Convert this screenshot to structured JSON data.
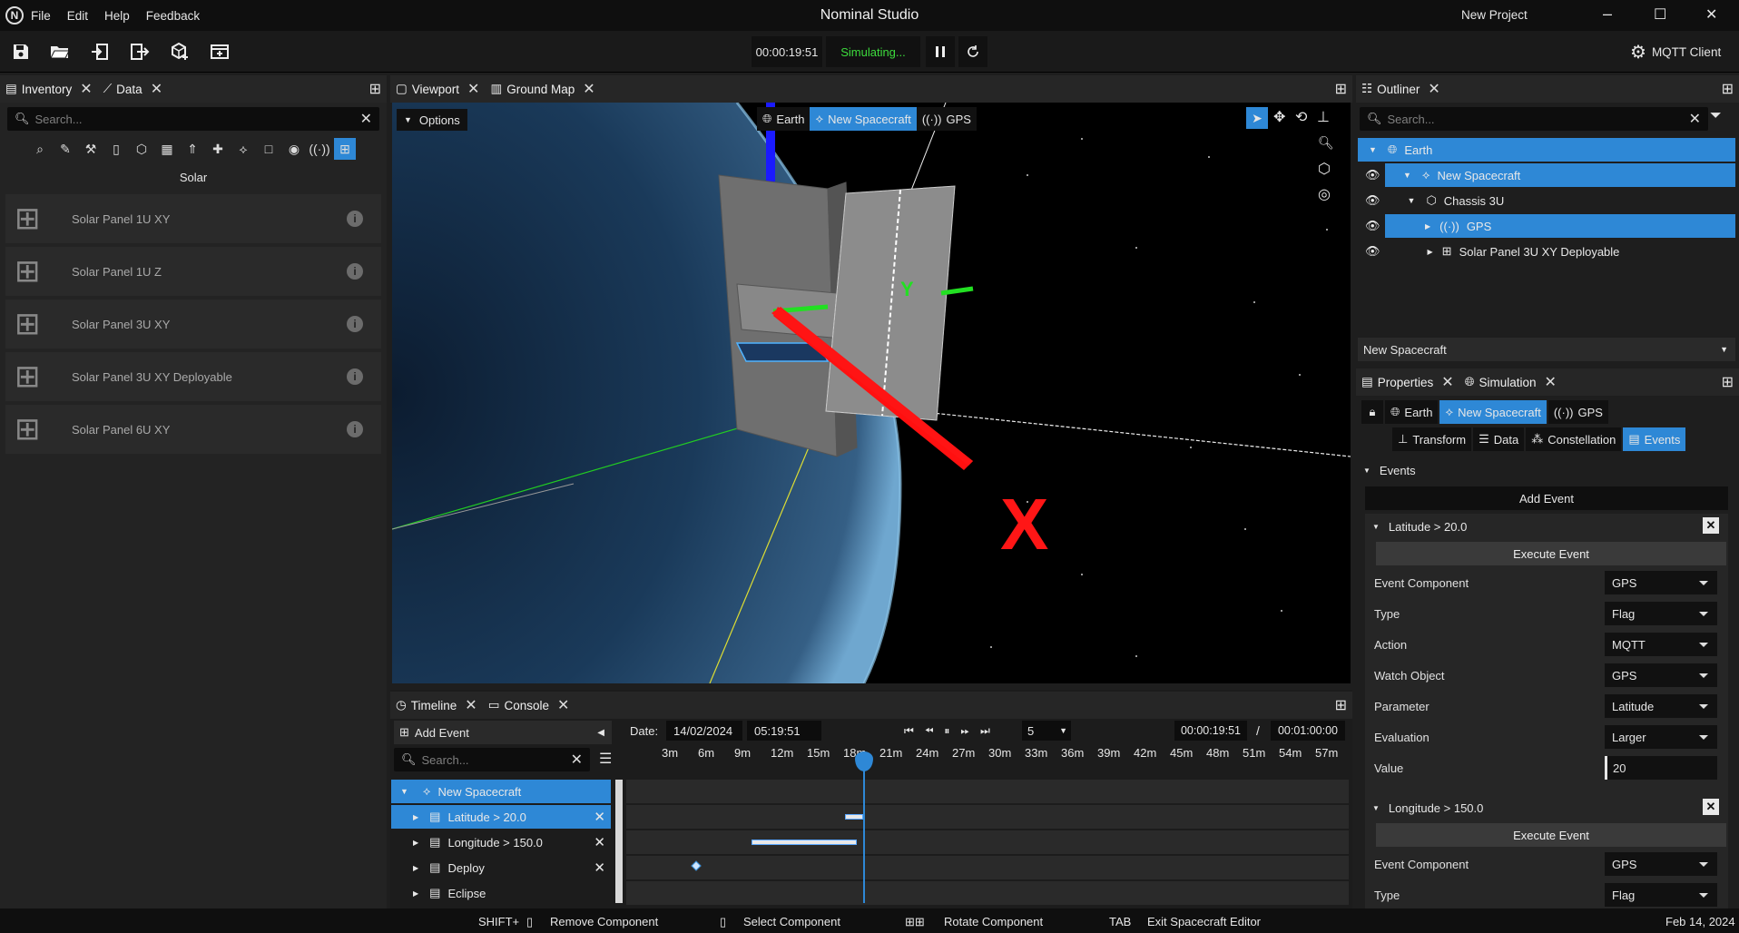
{
  "app": {
    "logo": "N",
    "menu": [
      "File",
      "Edit",
      "Help",
      "Feedback"
    ],
    "title": "Nominal Studio",
    "project": "New Project",
    "window": {
      "min": "–",
      "max": "☐",
      "close": "✕"
    }
  },
  "toolbar": {
    "icons": [
      "save-icon",
      "open-folder-icon",
      "import-icon",
      "export-icon",
      "add-cube-icon",
      "add-panel-icon"
    ],
    "sim_time": "00:00:19:51",
    "sim_status": "Simulating...",
    "mqtt": "MQTT Client"
  },
  "inventory": {
    "tabs": [
      "Inventory",
      "Data"
    ],
    "search_placeholder": "Search...",
    "category": "Solar",
    "items": [
      "Solar Panel 1U XY",
      "Solar Panel 1U Z",
      "Solar Panel 3U XY",
      "Solar Panel 3U XY Deployable",
      "Solar Panel 6U XY"
    ]
  },
  "viewport": {
    "tabs": [
      "Viewport",
      "Ground Map"
    ],
    "options": "Options",
    "crumbs": [
      "Earth",
      "New Spacecraft",
      "GPS"
    ],
    "axis_y": "Y",
    "axis_x": "X"
  },
  "outliner": {
    "tab": "Outliner",
    "search_placeholder": "Search...",
    "nodes": [
      {
        "label": "Earth"
      },
      {
        "label": "New Spacecraft"
      },
      {
        "label": "Chassis 3U"
      },
      {
        "label": "GPS"
      },
      {
        "label": "Solar Panel 3U XY Deployable"
      }
    ],
    "dropdown": "New Spacecraft"
  },
  "properties": {
    "tabs": [
      "Properties",
      "Simulation"
    ],
    "crumbs": [
      "Earth",
      "New Spacecraft",
      "GPS"
    ],
    "subtabs": [
      "Transform",
      "Data",
      "Constellation",
      "Events"
    ],
    "section": "Events",
    "add_event": "Add Event",
    "event1": {
      "title": "Latitude > 20.0",
      "execute": "Execute Event",
      "fields": [
        {
          "label": "Event Component",
          "value": "GPS"
        },
        {
          "label": "Type",
          "value": "Flag"
        },
        {
          "label": "Action",
          "value": "MQTT"
        },
        {
          "label": "Watch Object",
          "value": "GPS"
        },
        {
          "label": "Parameter",
          "value": "Latitude"
        },
        {
          "label": "Evaluation",
          "value": "Larger"
        },
        {
          "label": "Value",
          "value": "20"
        }
      ]
    },
    "event2": {
      "title": "Longitude > 150.0",
      "execute": "Execute Event",
      "fields": [
        {
          "label": "Event Component",
          "value": "GPS"
        },
        {
          "label": "Type",
          "value": "Flag"
        }
      ]
    }
  },
  "timeline": {
    "tabs": [
      "Timeline",
      "Console"
    ],
    "add_event": "Add Event",
    "search_placeholder": "Search...",
    "date_label": "Date:",
    "date": "14/02/2024",
    "time": "05:19:51",
    "speed": "5",
    "current": "00:00:19:51",
    "slash": "/",
    "total": "00:01:00:00",
    "ticks": [
      "3m",
      "6m",
      "9m",
      "12m",
      "15m",
      "18m",
      "21m",
      "24m",
      "27m",
      "30m",
      "33m",
      "36m",
      "39m",
      "42m",
      "45m",
      "48m",
      "51m",
      "54m",
      "57m"
    ],
    "rows": [
      "New Spacecraft",
      "Latitude > 20.0",
      "Longitude > 150.0",
      "Deploy",
      "Eclipse"
    ]
  },
  "statusbar": {
    "items": [
      {
        "key": "SHIFT+",
        "action": "Remove Component"
      },
      {
        "key": "",
        "action": "Select Component"
      },
      {
        "key": "",
        "action": "Rotate Component"
      },
      {
        "key": "TAB",
        "action": "Exit Spacecraft Editor"
      }
    ],
    "date": "Feb 14, 2024"
  },
  "colors": {
    "accent": "#2e88d6",
    "green_status": "#3ddc3d"
  }
}
